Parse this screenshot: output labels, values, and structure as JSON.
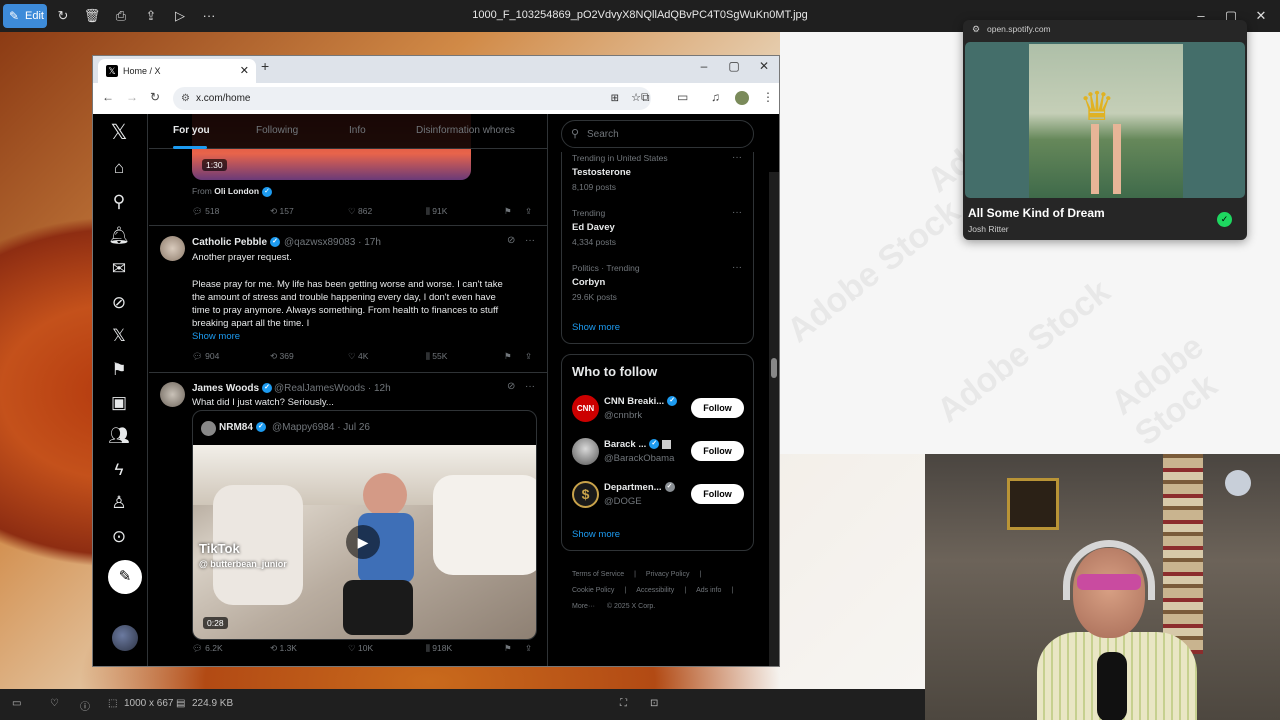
{
  "viewer": {
    "edit_label": "Edit",
    "file_name": "1000_F_103254869_pO2VdvyX8NQllAdQBvPC4T0SgWuKn0MT.jpg",
    "dimensions": "1000 x 667",
    "file_size": "224.9 KB"
  },
  "watermark": "Adobe Stock",
  "browser": {
    "tab_title": "Home / X",
    "url": "x.com/home"
  },
  "x": {
    "tabs": [
      "For you",
      "Following",
      "Info",
      "Disinformation whores"
    ],
    "tweet1": {
      "duration": "1:30",
      "from_label": "From",
      "from_name": "Oli London",
      "replies": "518",
      "reposts": "157",
      "likes": "862",
      "views": "91K"
    },
    "tweet2": {
      "name": "Catholic Pebble",
      "handle": "@qazwsx89083 · 17h",
      "line1": "Another prayer request.",
      "line2": "Please pray for me. My life has been getting worse and worse. I can't take",
      "line3": "the amount of stress and trouble happening every day, I don't even have",
      "line4": "time to pray anymore. Always something. From health to finances to stuff",
      "line5": "breaking apart all the time. I",
      "show_more": "Show more",
      "replies": "904",
      "reposts": "369",
      "likes": "4K",
      "views": "55K"
    },
    "tweet3": {
      "name": "James Woods",
      "handle": "@RealJamesWoods · 12h",
      "text": "What did I just watch? Seriously...",
      "quote_name": "NRM84",
      "quote_handle": "@Mappy6984 · Jul 26",
      "tiktok": "TikTok",
      "tiktok_user": "@ butterbean_junior",
      "duration": "0:28",
      "replies": "6.2K",
      "reposts": "1.3K",
      "likes": "10K",
      "views": "918K"
    },
    "search_placeholder": "Search",
    "trends": [
      {
        "context": "Trending in United States",
        "name": "Testosterone",
        "count": "8,109 posts"
      },
      {
        "context": "Trending",
        "name": "Ed Davey",
        "count": "4,334 posts"
      },
      {
        "context": "Politics · Trending",
        "name": "Corbyn",
        "count": "29.6K posts"
      }
    ],
    "show_more": "Show more",
    "who_title": "Who to follow",
    "who": [
      {
        "name": "CNN Breaki...",
        "handle": "@cnnbrk",
        "button": "Follow"
      },
      {
        "name": "Barack ...",
        "handle": "@BarackObama",
        "button": "Follow"
      },
      {
        "name": "Departmen...",
        "handle": "@DOGE",
        "button": "Follow"
      }
    ],
    "footer": [
      "Terms of Service",
      "Privacy Policy",
      "Cookie Policy",
      "Accessibility",
      "Ads info",
      "More···",
      "© 2025 X Corp."
    ]
  },
  "spotify": {
    "url": "open.spotify.com",
    "title": "All Some Kind of Dream",
    "artist": "Josh Ritter"
  },
  "colors": {
    "accent": "#1d9bf0",
    "spotify_green": "#1ed760",
    "edit_blue": "#3d8bd9"
  }
}
